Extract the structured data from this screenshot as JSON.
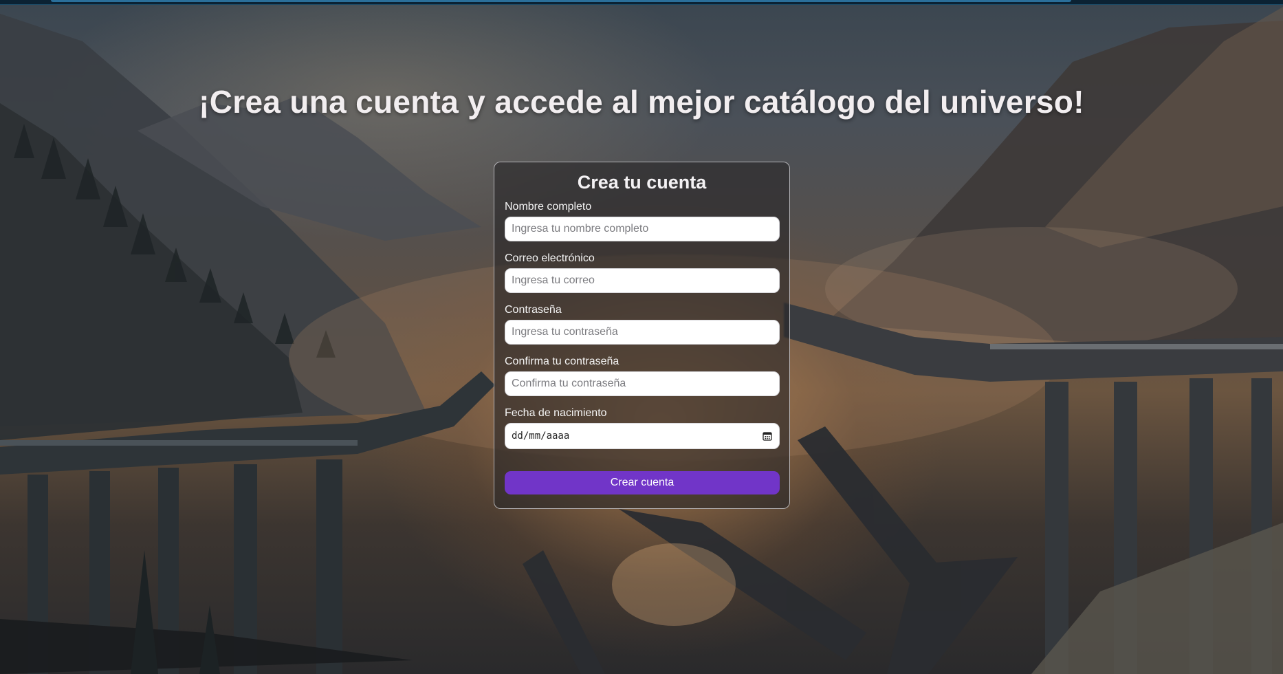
{
  "page": {
    "headline": "¡Crea una cuenta y accede al mejor catálogo del universo!"
  },
  "form": {
    "title": "Crea tu cuenta",
    "fields": [
      {
        "label": "Nombre completo",
        "placeholder": "Ingresa tu nombre completo",
        "value": ""
      },
      {
        "label": "Correo electrónico",
        "placeholder": "Ingresa tu correo",
        "value": ""
      },
      {
        "label": "Contraseña",
        "placeholder": "Ingresa tu contraseña",
        "value": ""
      },
      {
        "label": "Confirma tu contraseña",
        "placeholder": "Confirma tu contraseña",
        "value": ""
      }
    ],
    "birthdate": {
      "label": "Fecha de nacimiento",
      "display": "dd/mm/aaaa",
      "icon": "calendar-icon"
    },
    "submit_label": "Crear cuenta"
  },
  "colors": {
    "accent": "#7135c8",
    "headline_text": "#f2eef0",
    "card_border": "#dcdce1"
  }
}
